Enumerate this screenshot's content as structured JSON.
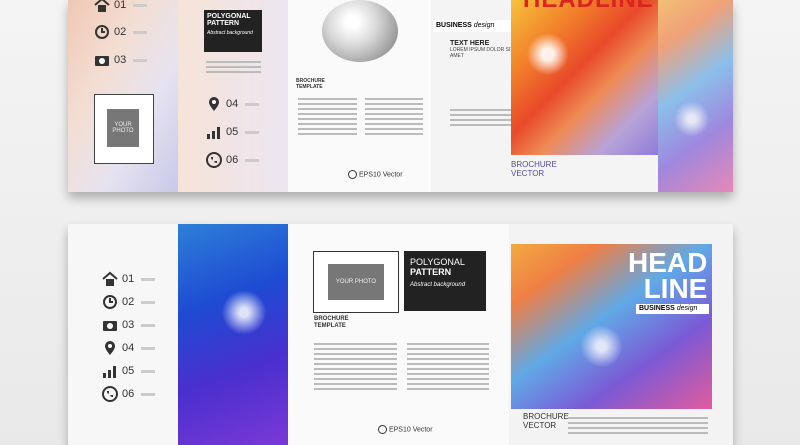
{
  "icons_top": [
    {
      "icon": "home-icon",
      "num": "01"
    },
    {
      "icon": "clock-icon",
      "num": "02"
    },
    {
      "icon": "camera-icon",
      "num": "03"
    },
    {
      "icon": "pin-icon",
      "num": "04"
    },
    {
      "icon": "chart-icon",
      "num": "05"
    },
    {
      "icon": "phone-icon",
      "num": "06"
    }
  ],
  "icons_bottom": [
    {
      "icon": "home-icon",
      "num": "01"
    },
    {
      "icon": "clock-icon",
      "num": "02"
    },
    {
      "icon": "camera-icon",
      "num": "03"
    },
    {
      "icon": "pin-icon",
      "num": "04"
    },
    {
      "icon": "chart-icon",
      "num": "05"
    },
    {
      "icon": "phone-icon",
      "num": "06"
    }
  ],
  "photo_label": "YOUR PHOTO",
  "polygonal": "POLYGONAL",
  "pattern": "PATTERN",
  "abstract_bg": "Abstract background",
  "headline_top": "HEADLINE",
  "head": "HEAD",
  "line": "LINE",
  "business": "BUSINESS",
  "design": "design",
  "text_here": "TEXT HERE",
  "lorem": "LOREM IPSUM DOLOR SIT AMET",
  "brochure": "BROCHURE",
  "vector": "VECTOR",
  "template": "TEMPLATE",
  "eps": "EPS10 Vector"
}
